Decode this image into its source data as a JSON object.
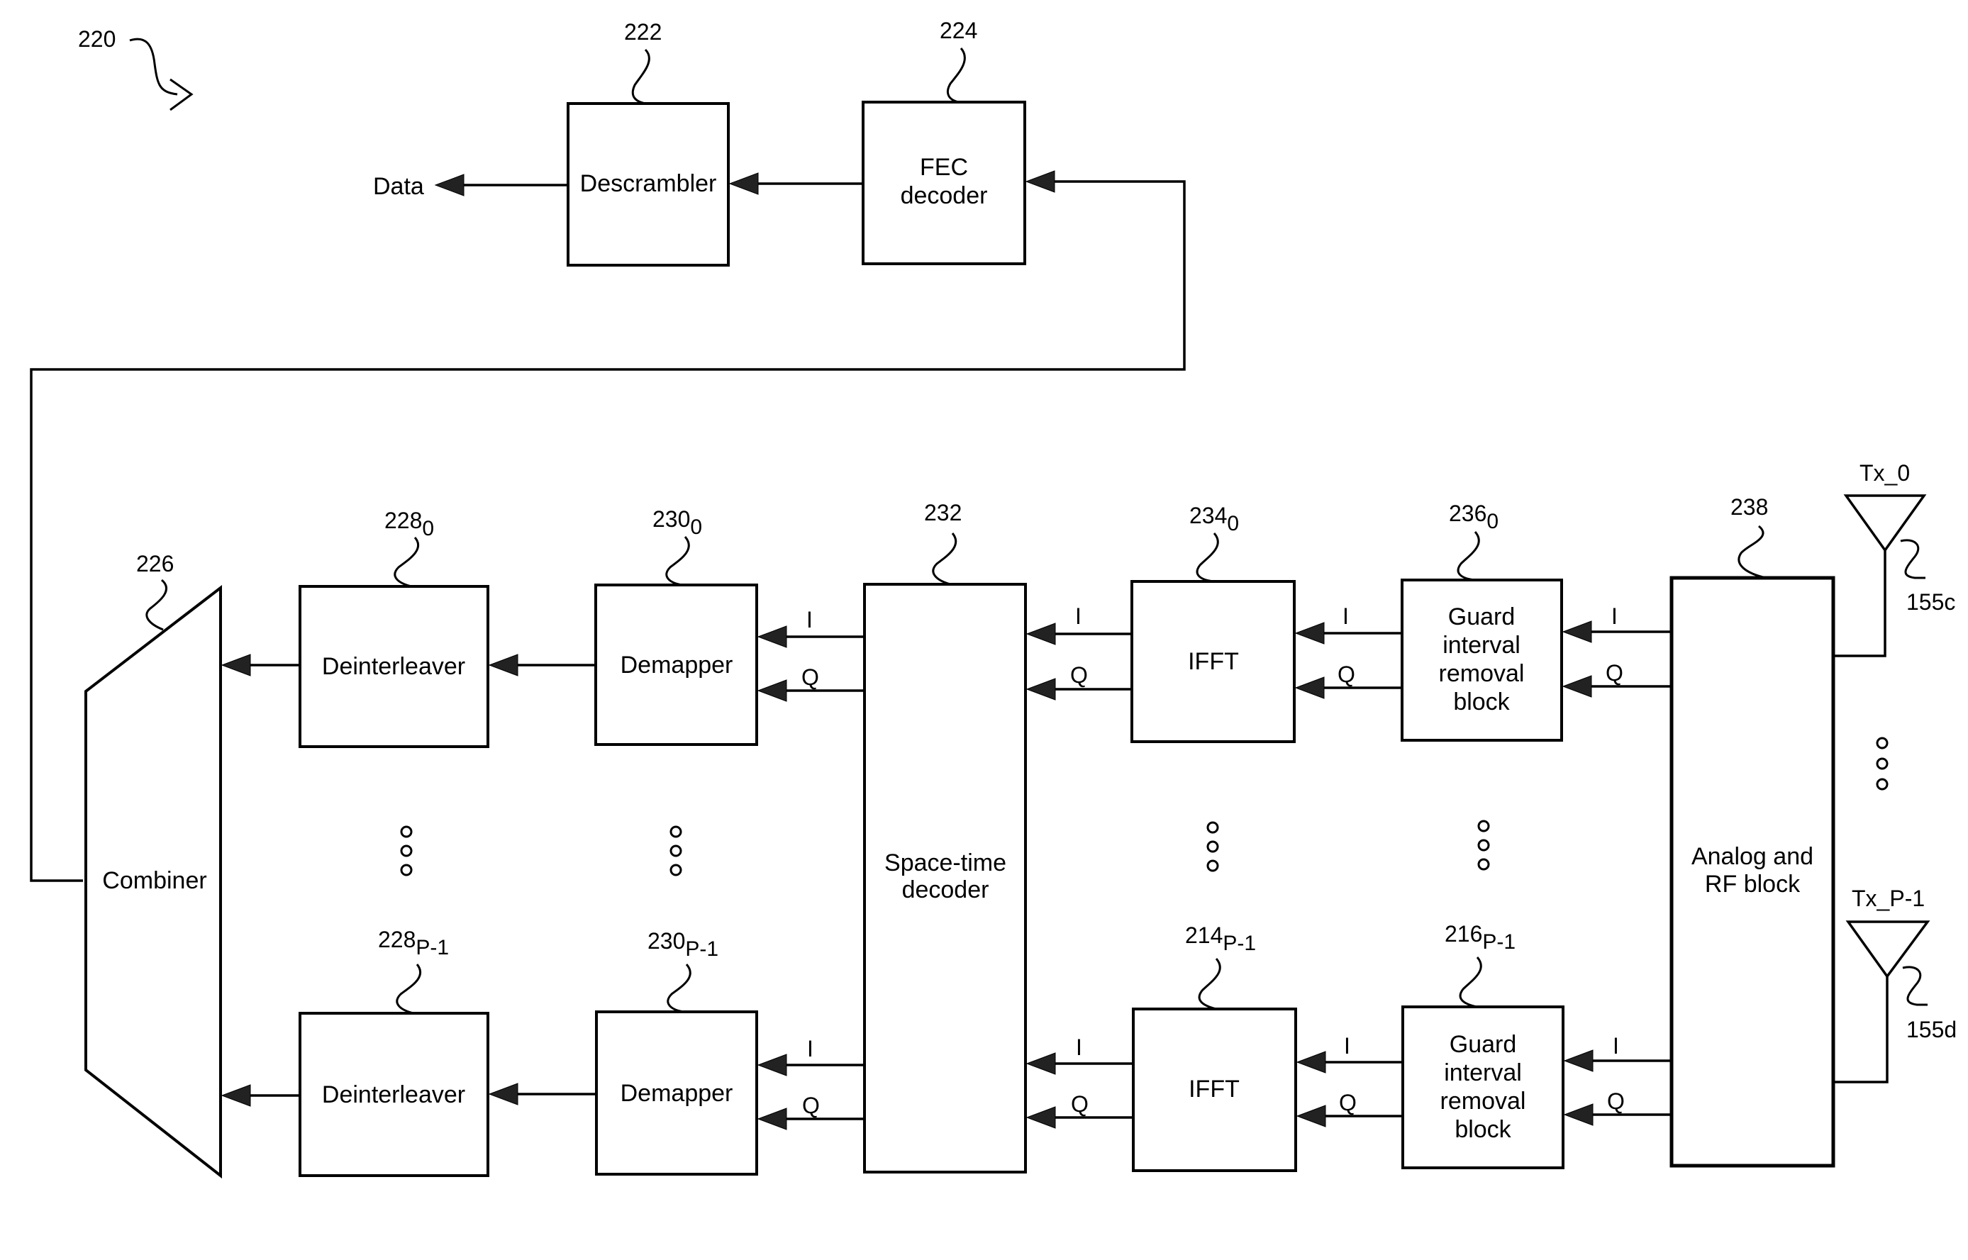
{
  "figure": {
    "ref": "220",
    "output_label": "Data",
    "blocks": {
      "descrambler": {
        "ref": "222",
        "lines": [
          "Descrambler"
        ]
      },
      "fec_decoder": {
        "ref": "224",
        "lines": [
          "FEC",
          "decoder"
        ]
      },
      "combiner": {
        "ref": "226",
        "lines": [
          "Combiner"
        ]
      },
      "deinterleaver_0": {
        "ref": "228",
        "sub": "0",
        "lines": [
          "Deinterleaver"
        ]
      },
      "deinterleaver_p1": {
        "ref": "228",
        "sub": "P-1",
        "lines": [
          "Deinterleaver"
        ]
      },
      "demapper_0": {
        "ref": "230",
        "sub": "0",
        "lines": [
          "Demapper"
        ]
      },
      "demapper_p1": {
        "ref": "230",
        "sub": "P-1",
        "lines": [
          "Demapper"
        ]
      },
      "space_time_decoder": {
        "ref": "232",
        "lines": [
          "Space-time",
          "decoder"
        ]
      },
      "ifft_0": {
        "ref": "234",
        "sub": "0",
        "lines": [
          "IFFT"
        ]
      },
      "ifft_p1": {
        "ref": "214",
        "sub": "P-1",
        "lines": [
          "IFFT"
        ]
      },
      "guard_0": {
        "ref": "236",
        "sub": "0",
        "lines": [
          "Guard",
          "interval",
          "removal",
          "block"
        ]
      },
      "guard_p1": {
        "ref": "216",
        "sub": "P-1",
        "lines": [
          "Guard",
          "interval",
          "removal",
          "block"
        ]
      },
      "analog_rf": {
        "ref": "238",
        "lines": [
          "Analog and",
          "RF block"
        ]
      }
    },
    "signals": {
      "i": "I",
      "q": "Q"
    },
    "antennas": [
      {
        "label": "Tx_0",
        "ref": "155c"
      },
      {
        "label": "Tx_P-1",
        "ref": "155d"
      }
    ],
    "ellipsis": "o"
  }
}
